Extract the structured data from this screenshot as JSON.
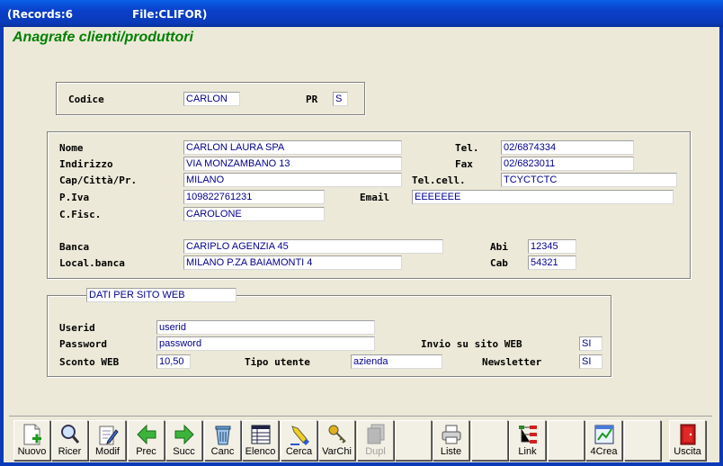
{
  "window": {
    "records": "(Records:6",
    "file": "File:CLIFOR)"
  },
  "form": {
    "title": "Anagrafe clienti/produttori"
  },
  "codice": {
    "label": "Codice",
    "value": "CARLON",
    "pr_label": "PR",
    "pr_value": "S"
  },
  "anagrafica": {
    "nome_label": "Nome",
    "nome": "CARLON LAURA SPA",
    "indirizzo_label": "Indirizzo",
    "indirizzo": "VIA MONZAMBANO 13",
    "cap_label": "Cap/Città/Pr.",
    "citta": "MILANO",
    "piva_label": "P.Iva",
    "piva": "109822761231",
    "cfisc_label": "C.Fisc.",
    "cfisc": "CAROLONE",
    "tel_label": "Tel.",
    "tel": "02/6874334",
    "fax_label": "Fax",
    "fax": "02/6823011",
    "cell_label": "Tel.cell.",
    "cell": "TCYCTCTC",
    "email_label": "Email",
    "email": "EEEEEEE",
    "banca_label": "Banca",
    "banca": "CARIPLO AGENZIA 45",
    "localbanca_label": "Local.banca",
    "localbanca": "MILANO P.ZA BAIAMONTI 4",
    "abi_label": "Abi",
    "abi": "12345",
    "cab_label": "Cab",
    "cab": "54321"
  },
  "web": {
    "group_title": "DATI PER SITO WEB",
    "userid_label": "Userid",
    "userid": "userid",
    "password_label": "Password",
    "password": "password",
    "sconto_label": "Sconto WEB",
    "sconto": "10,50",
    "tipo_label": "Tipo utente",
    "tipo": "azienda",
    "invio_label": "Invio su sito WEB",
    "invio": "SI",
    "newsletter_label": "Newsletter",
    "newsletter": "SI"
  },
  "toolbar": {
    "nuovo": "Nuovo",
    "ricer": "Ricer",
    "modif": "Modif",
    "prec": "Prec",
    "succ": "Succ",
    "canc": "Canc",
    "elenco": "Elenco",
    "cerca": "Cerca",
    "varchi": "VarChi",
    "dupl": "Dupl",
    "liste": "Liste",
    "link": "Link",
    "crea": "4Crea",
    "uscita": "Uscita"
  },
  "colors": {
    "title_bar": "#0a3ab8",
    "form_title": "#008000",
    "field_text": "#00008b",
    "background": "#ece9d8"
  }
}
